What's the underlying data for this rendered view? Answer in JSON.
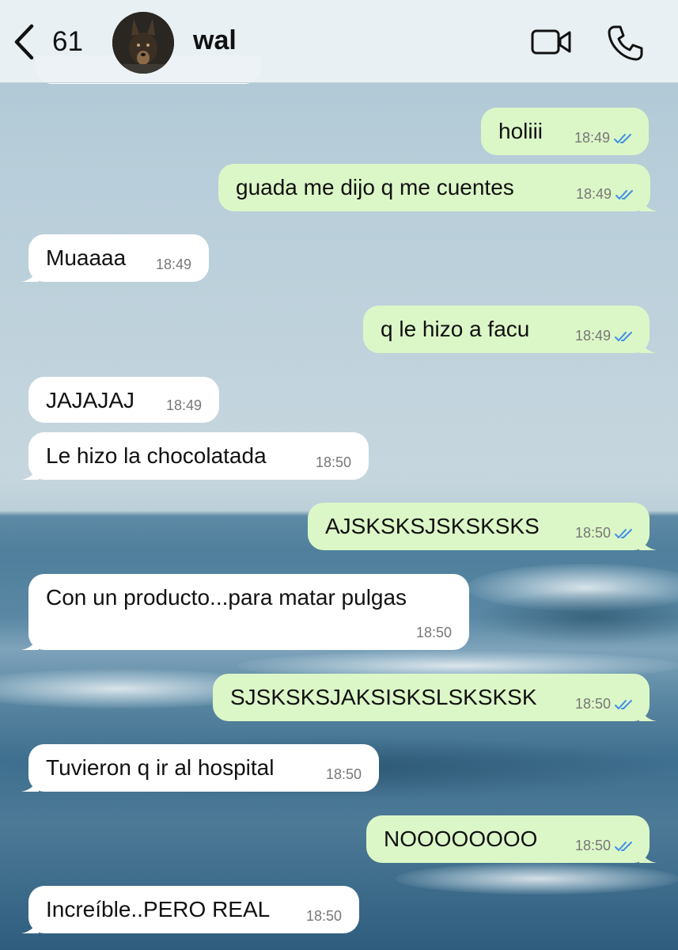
{
  "header": {
    "back_count": "61",
    "contact_name": "wal",
    "icons": {
      "back": "chevron-left-icon",
      "video": "video-camera-icon",
      "call": "phone-icon"
    }
  },
  "colors": {
    "outgoing_bubble": "#dcf7c7",
    "incoming_bubble": "#ffffff",
    "read_ticks": "#3d8fe6"
  },
  "messages": [
    {
      "direction": "out",
      "text": "holiii",
      "time": "18:49",
      "status": "read"
    },
    {
      "direction": "out",
      "text": "guada me dijo q me cuentes",
      "time": "18:49",
      "status": "read"
    },
    {
      "direction": "in",
      "text": "Muaaaa",
      "time": "18:49"
    },
    {
      "direction": "out",
      "text": "q le hizo a facu",
      "time": "18:49",
      "status": "read"
    },
    {
      "direction": "in",
      "text": "JAJAJAJ",
      "time": "18:49"
    },
    {
      "direction": "in",
      "text": "Le hizo la chocolatada",
      "time": "18:50"
    },
    {
      "direction": "out",
      "text": "AJSKSKSJSKSKSKS",
      "time": "18:50",
      "status": "read"
    },
    {
      "direction": "in",
      "text": "Con un producto...para matar pulgas",
      "time": "18:50"
    },
    {
      "direction": "out",
      "text": "SJSKSKSJAKSISKSLSKSKSK",
      "time": "18:50",
      "status": "read"
    },
    {
      "direction": "in",
      "text": "Tuvieron q ir al hospital",
      "time": "18:50"
    },
    {
      "direction": "out",
      "text": "NOOOOOOOO",
      "time": "18:50",
      "status": "read"
    },
    {
      "direction": "in",
      "text": "Increíble..PERO REAL",
      "time": "18:50"
    }
  ]
}
